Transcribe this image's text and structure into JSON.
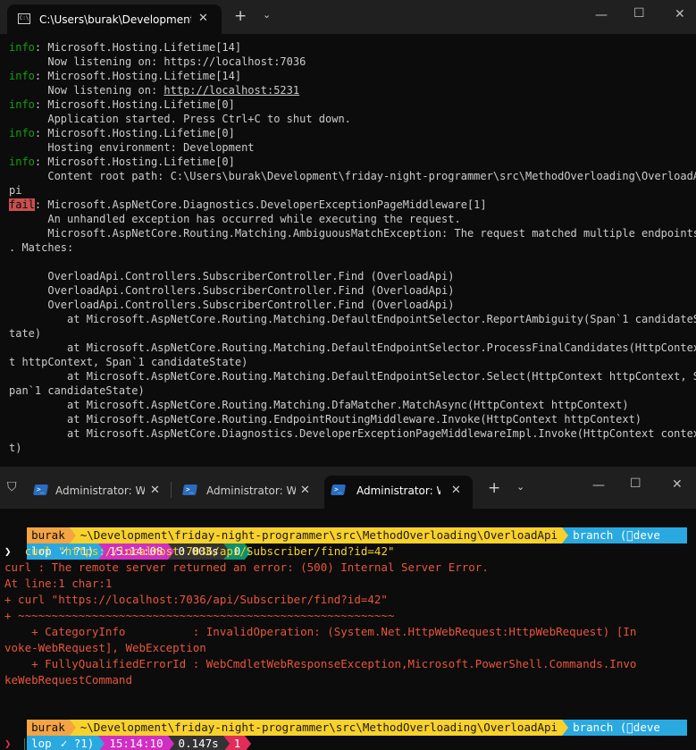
{
  "window1": {
    "tab_title": "C:\\Users\\burak\\Development'",
    "close_glyph": "✕",
    "new_tab_glyph": "+",
    "dropdown_glyph": "⌄",
    "minimize_glyph": "—",
    "maximize_glyph": "☐",
    "window_close_glyph": "✕",
    "log": {
      "l1_tag": "info",
      "l1_text": ": Microsoft.Hosting.Lifetime[14]",
      "l2": "      Now listening on: https://localhost:7036",
      "l3_tag": "info",
      "l3_text": ": Microsoft.Hosting.Lifetime[14]",
      "l4_prefix": "      Now listening on: ",
      "l4_link": "http://localhost:5231",
      "l5_tag": "info",
      "l5_text": ": Microsoft.Hosting.Lifetime[0]",
      "l6": "      Application started. Press Ctrl+C to shut down.",
      "l7_tag": "info",
      "l7_text": ": Microsoft.Hosting.Lifetime[0]",
      "l8": "      Hosting environment: Development",
      "l9_tag": "info",
      "l9_text": ": Microsoft.Hosting.Lifetime[0]",
      "l10": "      Content root path: C:\\Users\\burak\\Development\\friday-night-programmer\\src\\MethodOverloading\\OverloadA",
      "l11": "pi",
      "l12_tag": "fail",
      "l12_text": ": Microsoft.AspNetCore.Diagnostics.DeveloperExceptionPageMiddleware[1]",
      "l13": "      An unhandled exception has occurred while executing the request.",
      "l14": "      Microsoft.AspNetCore.Routing.Matching.AmbiguousMatchException: The request matched multiple endpoints",
      "l15": ". Matches:",
      "l16": "",
      "l17": "      OverloadApi.Controllers.SubscriberController.Find (OverloadApi)",
      "l18": "      OverloadApi.Controllers.SubscriberController.Find (OverloadApi)",
      "l19": "      OverloadApi.Controllers.SubscriberController.Find (OverloadApi)",
      "l20": "         at Microsoft.AspNetCore.Routing.Matching.DefaultEndpointSelector.ReportAmbiguity(Span`1 candidateS",
      "l21": "tate)",
      "l22": "         at Microsoft.AspNetCore.Routing.Matching.DefaultEndpointSelector.ProcessFinalCandidates(HttpContex",
      "l23": "t httpContext, Span`1 candidateState)",
      "l24": "         at Microsoft.AspNetCore.Routing.Matching.DefaultEndpointSelector.Select(HttpContext httpContext, S",
      "l25": "pan`1 candidateState)",
      "l26": "         at Microsoft.AspNetCore.Routing.Matching.DfaMatcher.MatchAsync(HttpContext httpContext)",
      "l27": "         at Microsoft.AspNetCore.Routing.EndpointRoutingMiddleware.Invoke(HttpContext httpContext)",
      "l28": "         at Microsoft.AspNetCore.Diagnostics.DeveloperExceptionPageMiddlewareImpl.Invoke(HttpContext contex",
      "l29": "t)"
    }
  },
  "window2": {
    "tabs": [
      {
        "label": "Administrator: W"
      },
      {
        "label": "Administrator: W"
      },
      {
        "label": "Administrator: W"
      }
    ],
    "close_glyph": "✕",
    "new_tab_glyph": "+",
    "dropdown_glyph": "⌄",
    "minimize_glyph": "—",
    "maximize_glyph": "☐",
    "window_close_glyph": "✕",
    "prompt1": {
      "user": "burak",
      "path": "~\\Development\\friday-night-programmer\\src\\MethodOverloading\\OverloadApi",
      "branch": "branch (deve",
      "branch_cont": "lop",
      "git_status": "✓ ?1)",
      "time": "15:14:08",
      "duration": "0.003s",
      "exit_code": "0"
    },
    "command_prompt_char": "❯",
    "command": "  curl \"https://localhost:7036/api/Subscriber/find?id=42\"",
    "error": {
      "e1": "curl : The remote server returned an error: (500) Internal Server Error.",
      "e2": "At line:1 char:1",
      "e3": "+ curl \"https://localhost:7036/api/Subscriber/find?id=42\"",
      "e4": "+ ~~~~~~~~~~~~~~~~~~~~~~~~~~~~~~~~~~~~~~~~~~~~~~~~~~~~~~~~",
      "e5": "    + CategoryInfo          : InvalidOperation: (System.Net.HttpWebRequest:HttpWebRequest) [In",
      "e6": "voke-WebRequest], WebException",
      "e7": "    + FullyQualifiedErrorId : WebCmdletWebResponseException,Microsoft.PowerShell.Commands.Invo",
      "e8": "keWebRequestCommand"
    },
    "prompt2": {
      "user": "burak",
      "path": "~\\Development\\friday-night-programmer\\src\\MethodOverloading\\OverloadApi",
      "branch": "branch (deve",
      "branch_cont": "lop",
      "git_status": "✓ ?1)",
      "time": "15:14:10",
      "duration": "0.147s",
      "exit_code": "1"
    },
    "final_prompt_char": "❯",
    "colors": {
      "user_bg": "#f4a442",
      "path_bg": "#f9d12b",
      "branch_bg": "#29a9e0",
      "time_bg": "#d12ec4",
      "duration_bg": "#0c0c0c",
      "exit_ok_bg": "#0f8f6a",
      "exit_fail_bg": "#e02d5a",
      "error_text": "#e8553b"
    }
  }
}
